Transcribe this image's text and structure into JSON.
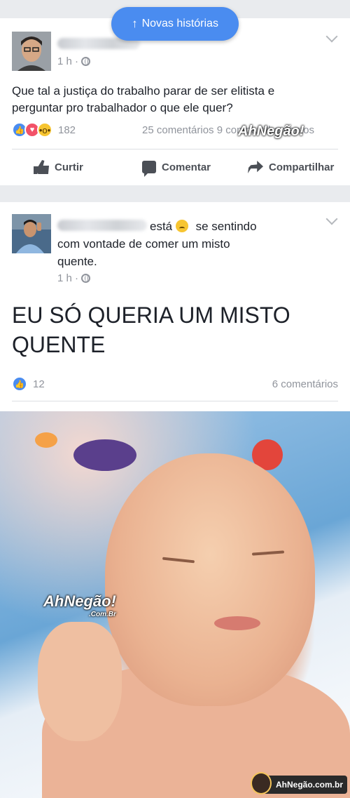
{
  "banner": {
    "label": "Novas histórias",
    "arrow": "↑"
  },
  "post1": {
    "time": "1 h ·",
    "text_line1": "Que tal a justiça do trabalho parar de ser elitista e",
    "text_line2": "perguntar pro trabalhador o que ele quer?",
    "reaction_count": "182",
    "comments_shares": "25 comentários 9 compartilhamentos",
    "actions": {
      "like": "Curtir",
      "comment": "Comentar",
      "share": "Compartilhar"
    }
  },
  "post2": {
    "feeling_verb": "está",
    "feeling_text_1": "se sentindo",
    "feeling_text_2": "com vontade de comer um misto",
    "feeling_text_3": "quente.",
    "time": "1 h ·",
    "big_line1": "EU SÓ QUERIA UM MISTO",
    "big_line2": "QUENTE",
    "reaction_count": "12",
    "comments": "6 comentários"
  },
  "watermarks": {
    "logo": "AhNegão!",
    "logo_sub": ".Com.Br",
    "footer": "AhNegão.com.br"
  },
  "colors": {
    "facebook_blue": "#4a8cf0",
    "meta_gray": "#90949c",
    "feed_bg": "#e9ebee"
  }
}
